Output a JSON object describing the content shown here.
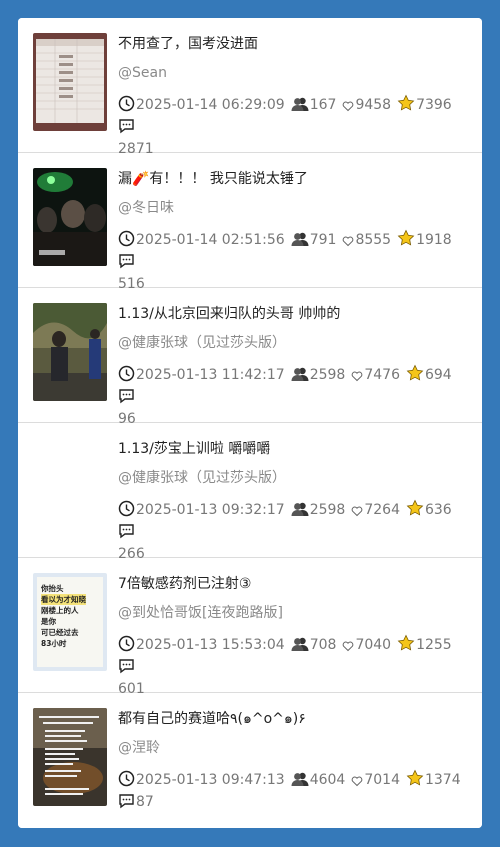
{
  "posts": [
    {
      "title": "不用查了，国考没进面",
      "author": "@Sean",
      "date": "2025-01-14 06:29:09",
      "views": "167",
      "likes": "9458",
      "stars": "7396",
      "comments": "2871",
      "thumb": "spreadsheet"
    },
    {
      "title": "漏🧨有！！！ 我只能说太锤了",
      "author": "@冬日味",
      "date": "2025-01-14 02:51:56",
      "views": "791",
      "likes": "8555",
      "stars": "1918",
      "comments": "516",
      "thumb": "night-crowd"
    },
    {
      "title": "1.13/从北京回来归队的头哥 帅帅的",
      "author": "@健康张球（见过莎头版）",
      "date": "2025-01-13 11:42:17",
      "views": "2598",
      "likes": "7476",
      "stars": "694",
      "comments": "96",
      "thumb": "street"
    },
    {
      "title": "1.13/莎宝上训啦 嚼嚼嚼",
      "author": "@健康张球（见过莎头版）",
      "date": "2025-01-13 09:32:17",
      "views": "2598",
      "likes": "7264",
      "stars": "636",
      "comments": "266",
      "thumb": "none"
    },
    {
      "title": "7倍敏感药剂已注射③",
      "author": "@到处恰哥饭[连夜跑路版]",
      "date": "2025-01-13 15:53:04",
      "views": "708",
      "likes": "7040",
      "stars": "1255",
      "comments": "601",
      "thumb": "note"
    },
    {
      "title": "都有自己的赛道哈٩(๑^o^๑)۶",
      "author": "@涅聆",
      "date": "2025-01-13 09:47:13",
      "views": "4604",
      "likes": "7014",
      "stars": "1374",
      "comments": "87",
      "thumb": "text-dark"
    }
  ],
  "thumb_text": {
    "note": [
      "你抬头",
      "看以为才知晓",
      "刚楼上的人",
      "是你",
      "可已经过去",
      "83小时"
    ]
  },
  "icons": {
    "time": "clock-icon",
    "views": "users-icon",
    "likes": "heart-icon",
    "stars": "star-icon",
    "comments": "comment-icon"
  },
  "colors": {
    "background": "#3579b9",
    "star": "#f5c518",
    "muted": "#777777"
  }
}
